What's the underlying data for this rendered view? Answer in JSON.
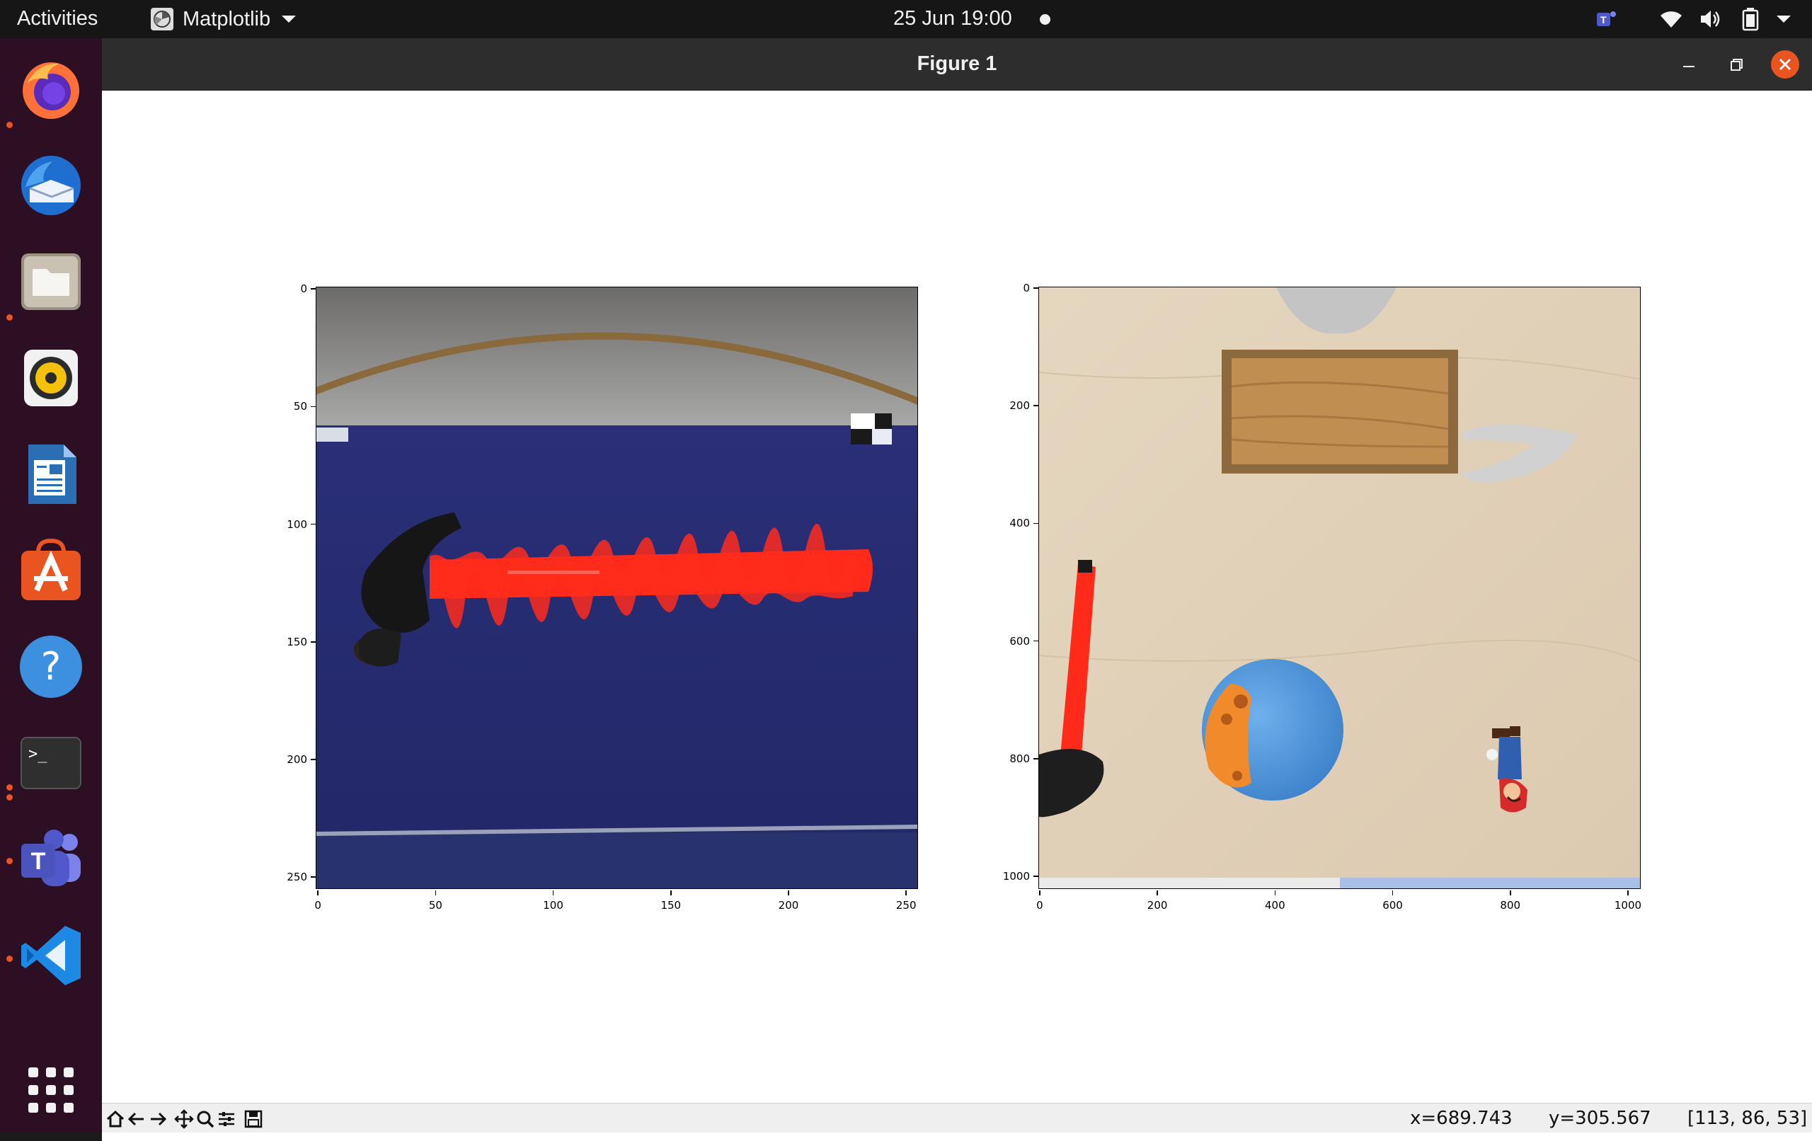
{
  "topbar": {
    "activities": "Activities",
    "app_name": "Matplotlib",
    "clock": "25 Jun  19:00"
  },
  "window": {
    "title": "Figure 1"
  },
  "dock": {
    "items": [
      "firefox-icon",
      "thunderbird-icon",
      "files-icon",
      "rhythmbox-icon",
      "libreoffice-writer-icon",
      "ubuntu-software-icon",
      "help-icon",
      "terminal-icon",
      "teams-icon",
      "vscode-icon",
      "show-apps-icon"
    ]
  },
  "figure": {
    "left_axes": {
      "xticks": [
        "0",
        "50",
        "100",
        "150",
        "200",
        "250"
      ],
      "yticks": [
        "0",
        "50",
        "100",
        "150",
        "200",
        "250"
      ]
    },
    "right_axes": {
      "xticks": [
        "0",
        "200",
        "400",
        "600",
        "800",
        "1000"
      ],
      "yticks": [
        "0",
        "200",
        "400",
        "600",
        "800",
        "1000"
      ]
    }
  },
  "toolbar": {
    "buttons": [
      "home-icon",
      "back-icon",
      "forward-icon",
      "pan-icon",
      "zoom-icon",
      "configure-icon",
      "save-icon"
    ]
  },
  "status": {
    "x": "x=689.743",
    "y": "y=305.567",
    "pixel": "[113, 86, 53]"
  }
}
